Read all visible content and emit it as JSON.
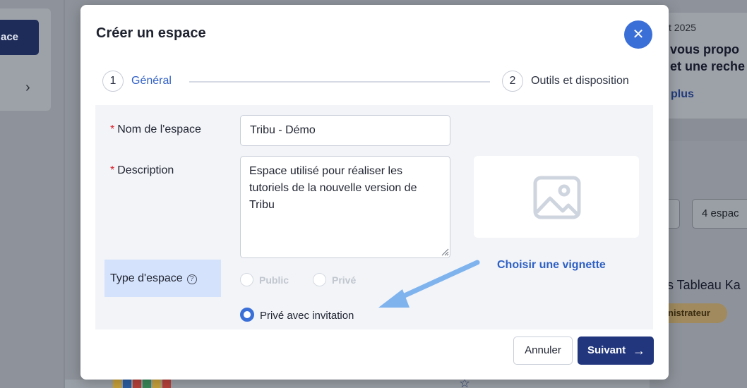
{
  "background": {
    "create_button_label": "ace",
    "date_fragment": "t 2025",
    "news_line1": "vous propo",
    "news_line2": "et une reche",
    "read_more": "plus",
    "space_count": "4 espac",
    "card_title": "s Tableau Ka",
    "role_badge": "nistrateur"
  },
  "modal": {
    "title": "Créer un espace",
    "close_icon": "close-icon",
    "steps": [
      {
        "number": "1",
        "label": "Général",
        "active": true
      },
      {
        "number": "2",
        "label": "Outils et disposition",
        "active": false
      }
    ],
    "form": {
      "name_label": "Nom de l'espace",
      "name_value": "Tribu - Démo",
      "required_mark": "*",
      "description_label": "Description",
      "description_value": "Espace utilisé pour réaliser les tutoriels de la nouvelle version de Tribu",
      "type_label": "Type d'espace",
      "help_icon": "question-circle-icon",
      "help_glyph": "?",
      "type_options": [
        {
          "label": "Public",
          "disabled": true,
          "selected": false
        },
        {
          "label": "Privé",
          "disabled": true,
          "selected": false
        },
        {
          "label": "Privé avec invitation",
          "disabled": false,
          "selected": true
        }
      ],
      "thumbnail_link": "Choisir une vignette",
      "thumbnail_icon": "image-placeholder-icon"
    },
    "footer": {
      "cancel_label": "Annuler",
      "next_label": "Suivant",
      "next_icon": "arrow-right-icon"
    }
  },
  "colors": {
    "accent": "#3b6fd8",
    "primary_button": "#22367e",
    "annotation_arrow": "#7fb3ee",
    "required": "#d6202a"
  }
}
